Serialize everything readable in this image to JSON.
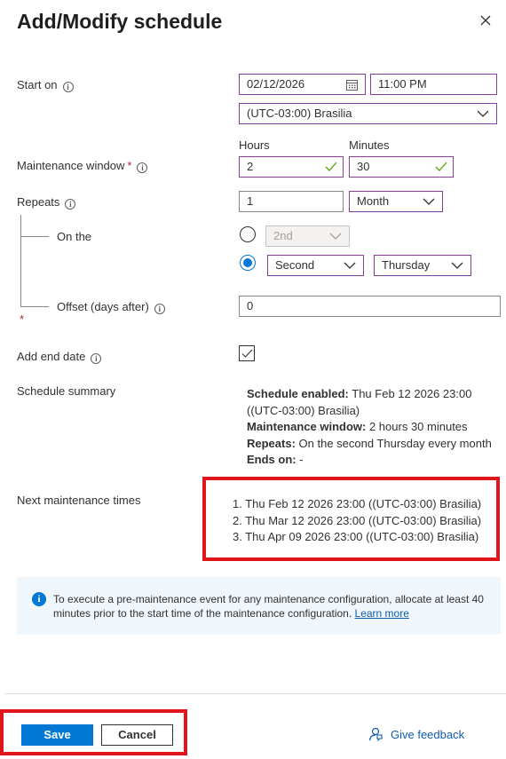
{
  "header": {
    "title": "Add/Modify schedule",
    "close_icon": "close-icon"
  },
  "start_on": {
    "label": "Start on",
    "date": "02/12/2026",
    "time": "11:00 PM",
    "timezone": "(UTC-03:00) Brasilia"
  },
  "maintenance_window": {
    "label": "Maintenance window",
    "required_mark": "*",
    "hours_label": "Hours",
    "minutes_label": "Minutes",
    "hours": "2",
    "minutes": "30"
  },
  "repeats": {
    "label": "Repeats",
    "count": "1",
    "unit": "Month",
    "on_the_label": "On the",
    "option1_day": "2nd",
    "option2_ordinal": "Second",
    "option2_weekday": "Thursday",
    "offset_label": "Offset (days after)",
    "offset_value": "0",
    "required_mark": "*"
  },
  "end_date": {
    "label": "Add end date"
  },
  "summary": {
    "label": "Schedule summary",
    "enabled_label": "Schedule enabled:",
    "enabled_value": "Thu Feb 12 2026 23:00 ((UTC-03:00) Brasilia)",
    "window_label": "Maintenance window:",
    "window_value": "2 hours 30 minutes",
    "repeats_label": "Repeats:",
    "repeats_value": "On the second Thursday every month",
    "ends_label": "Ends on:",
    "ends_value": "-"
  },
  "next_times": {
    "label": "Next maintenance times",
    "items": [
      "1. Thu Feb 12 2026 23:00 ((UTC-03:00) Brasilia)",
      "2. Thu Mar 12 2026 23:00 ((UTC-03:00) Brasilia)",
      "3. Thu Apr 09 2026 23:00 ((UTC-03:00) Brasilia)"
    ]
  },
  "banner": {
    "text": "To execute a pre-maintenance event for any maintenance configuration, allocate at least 40 minutes prior to the start time of the maintenance configuration.",
    "link": "Learn more"
  },
  "footer": {
    "save": "Save",
    "cancel": "Cancel",
    "feedback": "Give feedback"
  },
  "colors": {
    "accent": "#0078d4",
    "highlight_border": "#e1161b",
    "field_border_active": "#8a3e9c"
  }
}
